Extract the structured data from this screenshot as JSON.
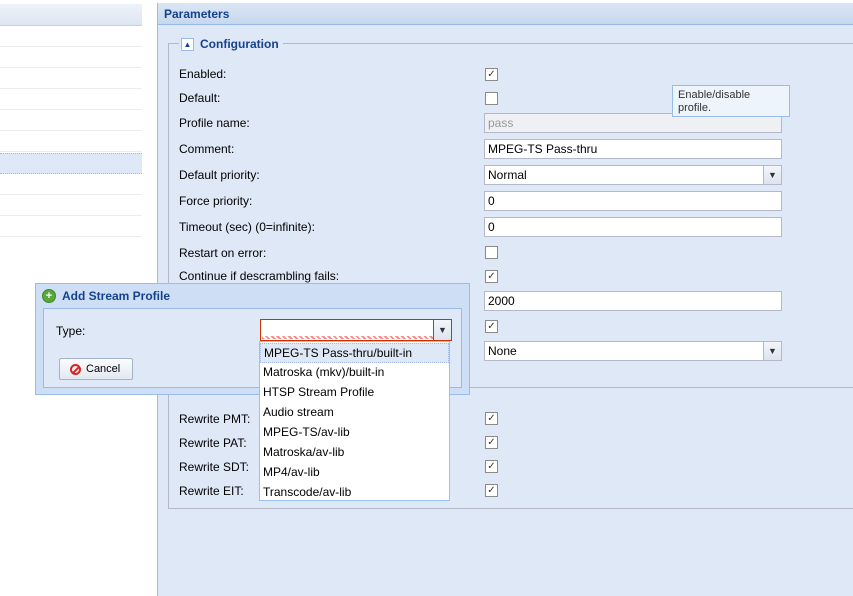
{
  "left_grid": {
    "row_count": 10,
    "selected_row": 7
  },
  "parameters": {
    "header": "Parameters",
    "configuration": {
      "legend": "Configuration",
      "enabled": {
        "label": "Enabled:",
        "checked": true
      },
      "default": {
        "label": "Default:",
        "checked": false
      },
      "profile_name": {
        "label": "Profile name:",
        "value": "pass"
      },
      "comment": {
        "label": "Comment:",
        "value": "MPEG-TS Pass-thru"
      },
      "default_priority": {
        "label": "Default priority:",
        "value": "Normal"
      },
      "force_priority": {
        "label": "Force priority:",
        "value": "0"
      },
      "timeout": {
        "label": "Timeout (sec) (0=infinite):",
        "value": "0"
      },
      "restart_on_error": {
        "label": "Restart on error:",
        "checked": false
      },
      "continue_descrambling": {
        "label": "Continue if descrambling fails:",
        "checked": true
      },
      "hidden_number_value": "2000",
      "hidden_checkbox_checked": true,
      "hidden_combo_value": "None"
    },
    "rewrite": {
      "pmt": {
        "label": "Rewrite PMT:",
        "checked": true
      },
      "pat": {
        "label": "Rewrite PAT:",
        "checked": true
      },
      "sdt": {
        "label": "Rewrite SDT:",
        "checked": true
      },
      "eit": {
        "label": "Rewrite EIT:",
        "checked": true
      }
    },
    "tooltip": "Enable/disable profile."
  },
  "dialog": {
    "title": "Add Stream Profile",
    "type_label": "Type:",
    "type_value": "",
    "cancel_label": "Cancel",
    "options": [
      "MPEG-TS Pass-thru/built-in",
      "Matroska (mkv)/built-in",
      "HTSP Stream Profile",
      "Audio stream",
      "MPEG-TS/av-lib",
      "Matroska/av-lib",
      "MP4/av-lib",
      "Transcode/av-lib"
    ],
    "highlighted_option": 0
  },
  "icons": {
    "check": "checkmark-icon",
    "collapse": "collapse-up-icon",
    "add": "add-circle-icon",
    "cancel": "cancel-icon",
    "dropdown": "chevron-down-icon"
  },
  "colors": {
    "panel_bg": "#dfe8f6",
    "title_text": "#15428b",
    "border": "#99bbe8",
    "invalid_border": "#cc3300"
  }
}
